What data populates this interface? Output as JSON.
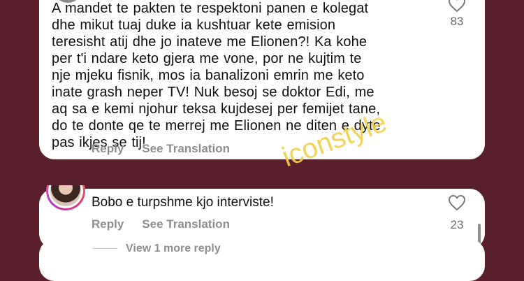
{
  "comment1": {
    "lines": [
      "A mandet te pakten te respektoni panen e kolegat",
      "dhe mikut tuaj duke ia kushtuar kete emision",
      "teresisht atij dhe jo inateve me Elionen?! Ka kohe",
      "per t'i ndare keto gjera me vone, por ne kujtim te",
      "nje mjeku fisnik, mos ia banalizoni emrin me keto",
      "inate grash neper TV! Nuk besoj se doktor Edi, me",
      "aq sa e kemi njohur teksa kujdesej per femijet tane,",
      "do te donte qe te merrej me Elionen ne diten e dyte",
      "pas ikjes se tij!"
    ],
    "reply_label": "Reply",
    "translate_label": "See Translation",
    "likes": "83"
  },
  "comment2": {
    "text": "Bobo e turpshme kjo interviste!",
    "reply_label": "Reply",
    "translate_label": "See Translation",
    "likes": "23"
  },
  "view_more": "View 1 more reply",
  "watermark": "iconstyle",
  "colors": {
    "background": "#5a1f2c",
    "card": "#ffffff",
    "muted": "#8e8e8e",
    "watermark": "#f2d04a"
  }
}
